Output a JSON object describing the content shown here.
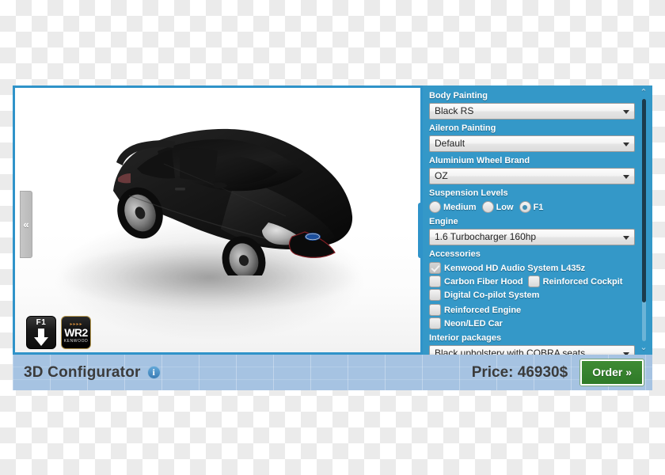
{
  "viewer": {
    "collapse_left_label": "«",
    "collapse_right_label": "»",
    "badges": [
      {
        "name": "f1-badge",
        "label": "F1"
      },
      {
        "name": "kenwood-badge",
        "title": "WR2",
        "subtitle": "KENWOOD"
      }
    ]
  },
  "panel": {
    "body_painting": {
      "label": "Body Painting",
      "value": "Black RS"
    },
    "aileron_painting": {
      "label": "Aileron Painting",
      "value": "Default"
    },
    "wheel_brand": {
      "label": "Aluminium Wheel Brand",
      "value": "OZ"
    },
    "suspension": {
      "label": "Suspension Levels",
      "options": [
        {
          "label": "Medium",
          "checked": false
        },
        {
          "label": "Low",
          "checked": false
        },
        {
          "label": "F1",
          "checked": true
        }
      ]
    },
    "engine": {
      "label": "Engine",
      "value": "1.6 Turbocharger 160hp"
    },
    "accessories": {
      "label": "Accessories",
      "row1": [
        {
          "label": "Kenwood HD Audio System L435z",
          "checked": true
        }
      ],
      "row2": [
        {
          "label": "Carbon Fiber Hood",
          "checked": false
        },
        {
          "label": "Reinforced Cockpit",
          "checked": false
        }
      ],
      "row3": [
        {
          "label": "Digital Co-pilot System",
          "checked": false
        },
        {
          "label": "Reinforced Engine",
          "checked": false
        }
      ],
      "row4": [
        {
          "label": "Neon/LED Car",
          "checked": false
        }
      ]
    },
    "interior": {
      "label": "Interior packages",
      "value": "Black upholstery with COBRA seats"
    },
    "scroll": {
      "up_label": "⌃",
      "down_label": "⌄"
    }
  },
  "bottombar": {
    "title": "3D Configurator",
    "info_label": "i",
    "price": "Price: 46930$",
    "order_label": "Order »"
  },
  "colors": {
    "panel_blue": "#3498c8",
    "frame_blue": "#2f93c9",
    "bottombar_blue": "#a6c3e2",
    "order_green": "#3e8b34"
  }
}
